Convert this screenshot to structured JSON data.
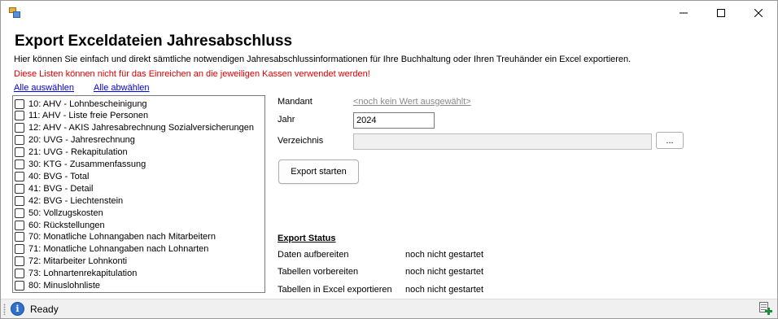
{
  "window": {
    "icons": {
      "app": "app-icon",
      "minimize": "minimize-icon",
      "maximize": "maximize-icon",
      "close": "close-icon"
    }
  },
  "header": {
    "title": "Export Exceldateien Jahresabschluss",
    "description": "Hier können Sie einfach und direkt sämtliche notwendigen Jahresabschlussinformationen für Ihre Buchhaltung oder Ihren Treuhänder ein Excel exportieren.",
    "warning": "Diese Listen können nicht für das Einreichen an die jeweiligen Kassen verwendet werden!",
    "warning_color": "#e00000"
  },
  "links": {
    "select_all": "Alle auswählen",
    "deselect_all": "Alle abwählen"
  },
  "reports": [
    {
      "label": "10: AHV - Lohnbescheinigung",
      "checked": false
    },
    {
      "label": "11: AHV - Liste freie Personen",
      "checked": false
    },
    {
      "label": "12: AHV - AKIS Jahresabrechnung Sozialversicherungen",
      "checked": false
    },
    {
      "label": "20: UVG - Jahresrechnung",
      "checked": false
    },
    {
      "label": "21: UVG - Rekapitulation",
      "checked": false
    },
    {
      "label": "30: KTG - Zusammenfassung",
      "checked": false
    },
    {
      "label": "40: BVG - Total",
      "checked": false
    },
    {
      "label": "41: BVG - Detail",
      "checked": false
    },
    {
      "label": "42: BVG - Liechtenstein",
      "checked": false
    },
    {
      "label": "50: Vollzugskosten",
      "checked": false
    },
    {
      "label": "60: Rückstellungen",
      "checked": false
    },
    {
      "label": "70: Monatliche Lohnangaben nach Mitarbeitern",
      "checked": false
    },
    {
      "label": "71: Monatliche Lohnangaben nach Lohnarten",
      "checked": false
    },
    {
      "label": "72: Mitarbeiter Lohnkonti",
      "checked": false
    },
    {
      "label": "73: Lohnartenrekapitulation",
      "checked": false
    },
    {
      "label": "80: Minuslohnliste",
      "checked": false
    }
  ],
  "form": {
    "mandant_label": "Mandant",
    "mandant_value": "<noch kein Wert ausgewählt>",
    "year_label": "Jahr",
    "year_value": "2024",
    "directory_label": "Verzeichnis",
    "directory_value": "",
    "browse_label": "...",
    "export_label": "Export starten"
  },
  "status": {
    "title": "Export Status",
    "rows": [
      {
        "label": "Daten aufbereiten",
        "value": "noch nicht gestartet"
      },
      {
        "label": "Tabellen vorbereiten",
        "value": "noch nicht gestartet"
      },
      {
        "label": "Tabellen in Excel exportieren",
        "value": "noch nicht gestartet"
      }
    ]
  },
  "statusbar": {
    "text": "Ready",
    "info_icon": "info-icon",
    "excel_icon": "excel-export-icon"
  }
}
